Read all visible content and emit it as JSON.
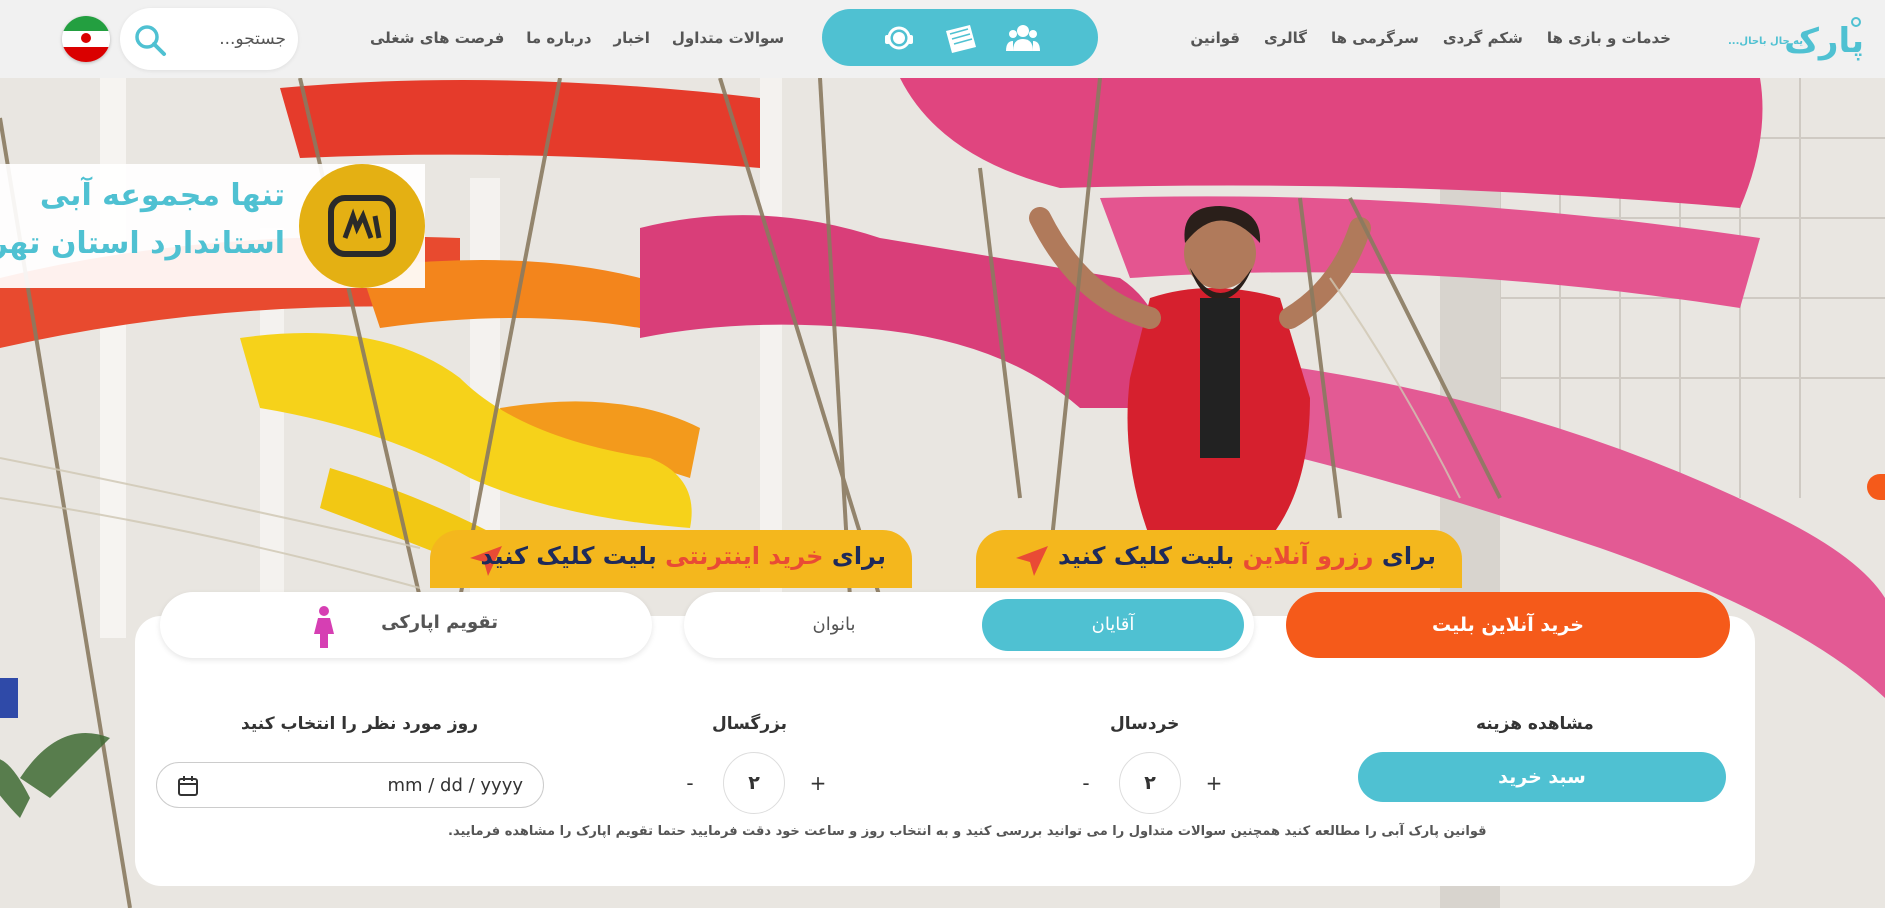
{
  "header": {
    "search": {
      "placeholder": "جستجو..."
    },
    "nav_left": [
      "سوالات متداول",
      "اخبار",
      "درباره ما",
      "فرصت های شغلی"
    ],
    "nav_right": [
      "خدمات و بازی ها",
      "شکم گردی",
      "سرگرمی ها",
      "گالری",
      "قوانین"
    ],
    "logo": {
      "tagline": "یه حال باحال..."
    },
    "pill_icons": [
      "users-icon",
      "ticket-icon",
      "support-icon"
    ],
    "flag": "iran-flag-icon"
  },
  "hero": {
    "badge": {
      "line1": "تنها مجموعه آبی",
      "line2": "استاندارد استان تهران"
    },
    "promo_left": {
      "prefix": "برای",
      "highlight": "خرید اینترنتی",
      "suffix": "بلیت کلیک کنید"
    },
    "promo_right": {
      "prefix": "برای",
      "highlight": "رزرو آنلاین",
      "suffix": "بلیت کلیک کنید"
    }
  },
  "booking": {
    "tabs": {
      "calendar": "تقویم اپارکی",
      "men": "آقایان",
      "women": "بانوان",
      "buy": "خرید آنلاین بلیت"
    },
    "cost_title": "مشاهده هزینه",
    "basket_button": "سبد خرید",
    "child": {
      "title": "خردسال",
      "count": "۲",
      "plus": "+",
      "minus": "-"
    },
    "adult": {
      "title": "بزرگسال",
      "count": "۲",
      "plus": "+",
      "minus": "-"
    },
    "date": {
      "title": "روز مورد نظر را انتخاب کنید",
      "placeholder": "mm / dd / yyyy"
    },
    "note": "قوانین پارک آبی را مطالعه کنید همچنین سوالات متداول را می توانید بررسی کنید و به انتخاب روز و ساعت خود دقت فرمایید حتما تقویم اپارک را مشاهده فرمایید."
  },
  "colors": {
    "accent": "#4fc1d2",
    "orange": "#f55a1a",
    "yellow": "#f4b71d",
    "pink": "#e0457f"
  }
}
